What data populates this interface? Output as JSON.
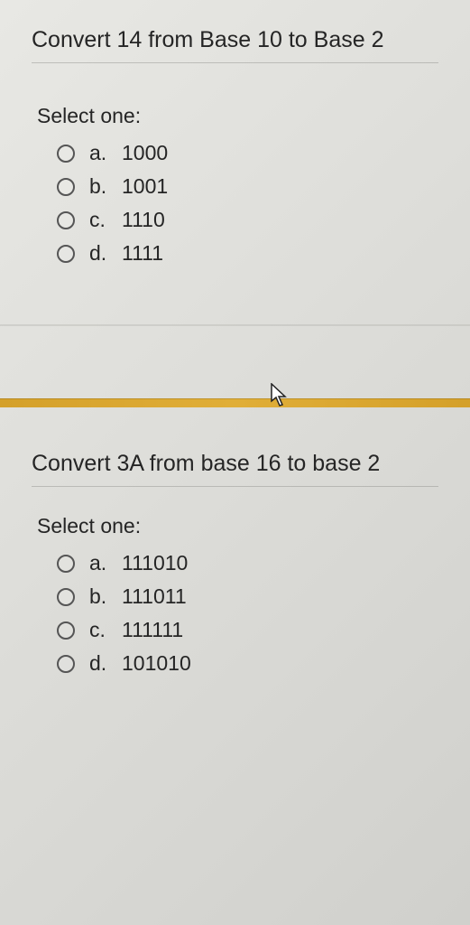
{
  "question1": {
    "prompt": "Convert 14 from Base 10 to Base 2",
    "select_label": "Select one:",
    "options": [
      {
        "letter": "a.",
        "value": "1000"
      },
      {
        "letter": "b.",
        "value": "1001"
      },
      {
        "letter": "c.",
        "value": "1110"
      },
      {
        "letter": "d.",
        "value": "1111"
      }
    ]
  },
  "question2": {
    "prompt": "Convert 3A from base 16 to base 2",
    "select_label": "Select one:",
    "options": [
      {
        "letter": "a.",
        "value": "111010"
      },
      {
        "letter": "b.",
        "value": "111011"
      },
      {
        "letter": "c.",
        "value": "111111"
      },
      {
        "letter": "d.",
        "value": "101010"
      }
    ]
  }
}
